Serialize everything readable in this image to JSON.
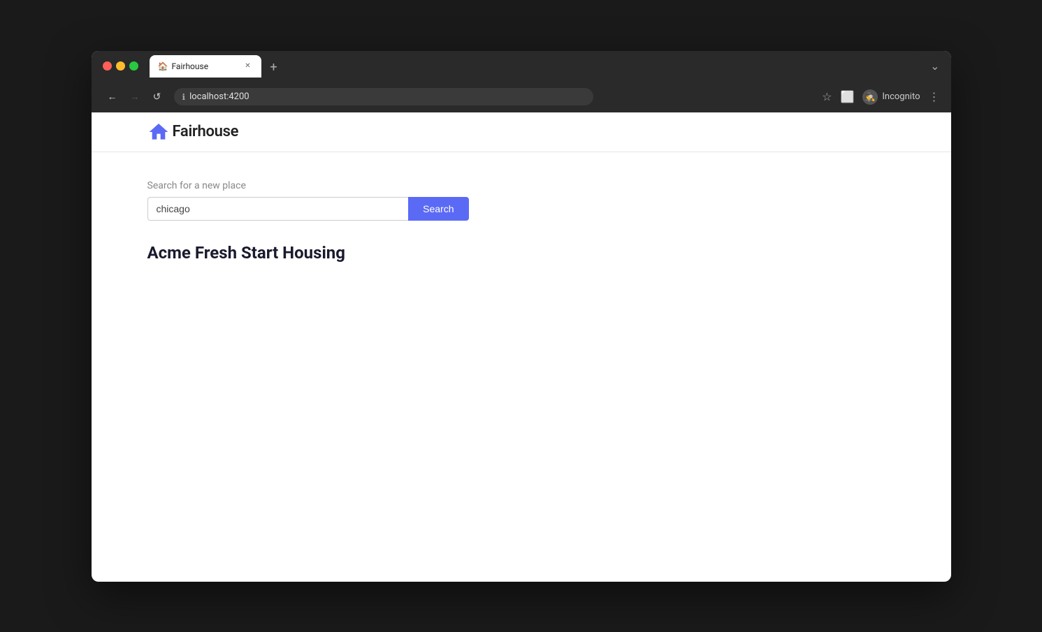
{
  "browser": {
    "tab_title": "Fairhouse",
    "tab_favicon": "🏠",
    "url": "localhost:4200",
    "new_tab_icon": "+",
    "chevron_down": "⌄",
    "nav": {
      "back": "←",
      "forward": "→",
      "refresh": "↺"
    },
    "toolbar": {
      "bookmark": "☆",
      "sidebar": "⬜",
      "incognito_label": "Incognito",
      "more": "⋮"
    }
  },
  "app": {
    "logo_text": "Fairhouse",
    "header": {
      "title": "Fairhouse"
    },
    "search": {
      "label": "Search for a new place",
      "placeholder": "chicago",
      "button_label": "Search"
    },
    "results": {
      "heading": "Acme Fresh Start Housing"
    }
  }
}
